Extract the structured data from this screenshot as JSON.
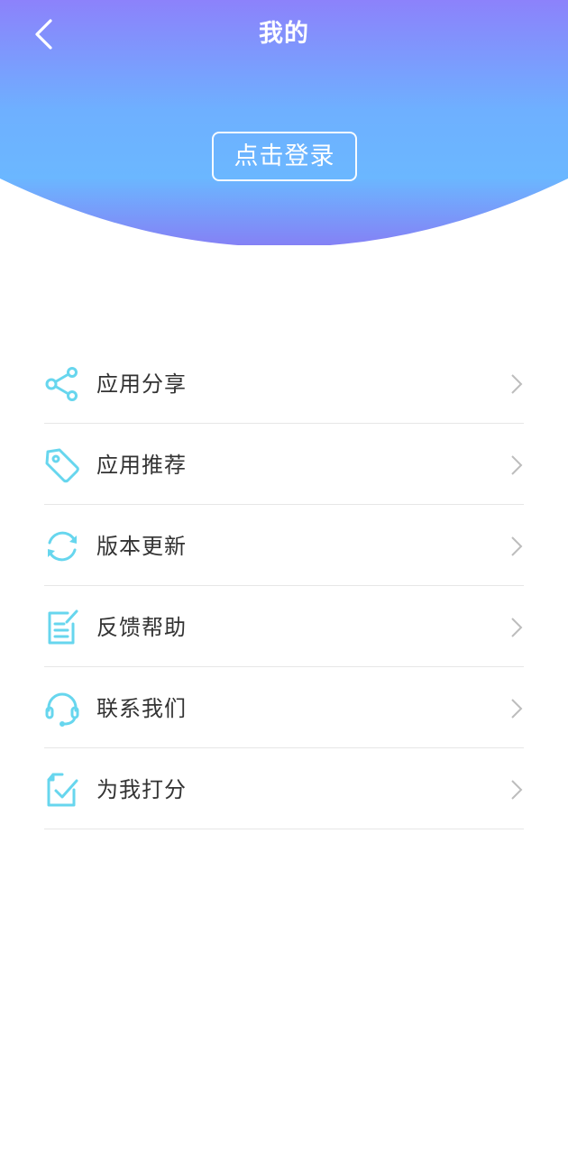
{
  "header": {
    "title": "我的",
    "back_icon": "chevron-left-icon",
    "login_label": "点击登录",
    "gradient_top": "#8c82fb",
    "gradient_mid": "#6cb6ff",
    "gradient_bottom": "#7f86f6"
  },
  "menu": {
    "icon_color": "#67d6ee",
    "items": [
      {
        "label": "应用分享",
        "icon": "share-icon"
      },
      {
        "label": "应用推荐",
        "icon": "tag-icon"
      },
      {
        "label": "版本更新",
        "icon": "refresh-icon"
      },
      {
        "label": "反馈帮助",
        "icon": "feedback-edit-icon"
      },
      {
        "label": "联系我们",
        "icon": "headset-icon"
      },
      {
        "label": "为我打分",
        "icon": "rating-check-icon"
      }
    ]
  }
}
